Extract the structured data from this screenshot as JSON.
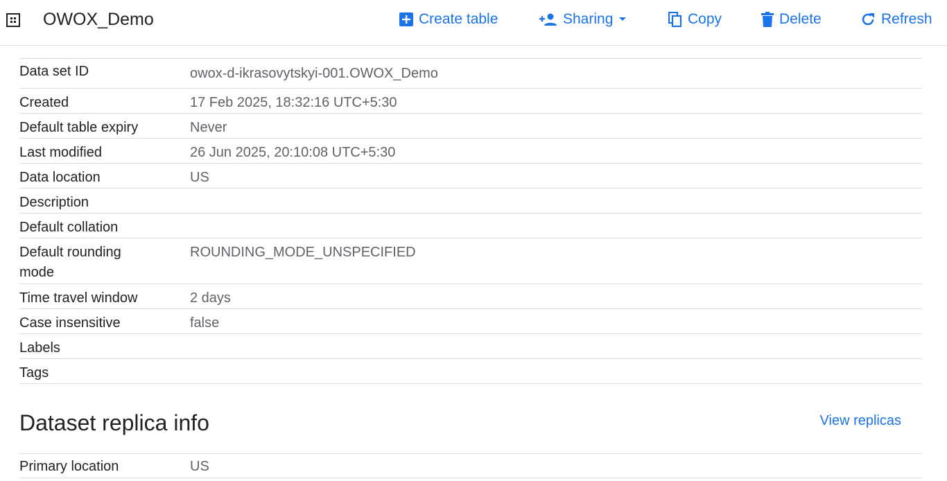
{
  "header": {
    "dataset_name": "OWOX_Demo",
    "actions": [
      {
        "label": "Create table",
        "icon": "add-box-icon"
      },
      {
        "label": "Sharing",
        "icon": "person-add-icon"
      },
      {
        "label": "Copy",
        "icon": "copy-icon"
      },
      {
        "label": "Delete",
        "icon": "trash-icon"
      },
      {
        "label": "Refresh",
        "icon": "refresh-icon"
      }
    ]
  },
  "details": [
    {
      "key": "Data set ID",
      "value": "owox-d-ikrasovytskyi-001.OWOX_Demo"
    },
    {
      "key": "Created",
      "value": "17 Feb 2025, 18:32:16 UTC+5:30"
    },
    {
      "key": "Default table expiry",
      "value": "Never"
    },
    {
      "key": "Last modified",
      "value": "26 Jun 2025, 20:10:08 UTC+5:30"
    },
    {
      "key": "Data location",
      "value": "US"
    },
    {
      "key": "Description",
      "value": ""
    },
    {
      "key": "Default collation",
      "value": ""
    },
    {
      "key": "Default rounding mode",
      "value": "ROUNDING_MODE_UNSPECIFIED"
    },
    {
      "key": "Time travel window",
      "value": "2 days"
    },
    {
      "key": "Case insensitive",
      "value": "false"
    },
    {
      "key": "Labels",
      "value": ""
    },
    {
      "key": "Tags",
      "value": ""
    }
  ],
  "replica": {
    "title": "Dataset replica info",
    "view_link": "View replicas",
    "rows": [
      {
        "key": "Primary location",
        "value": "US"
      }
    ]
  },
  "colors": {
    "accent": "#1a73e8",
    "text": "#202124",
    "muted": "#5f6368",
    "divider": "#dadce0"
  }
}
